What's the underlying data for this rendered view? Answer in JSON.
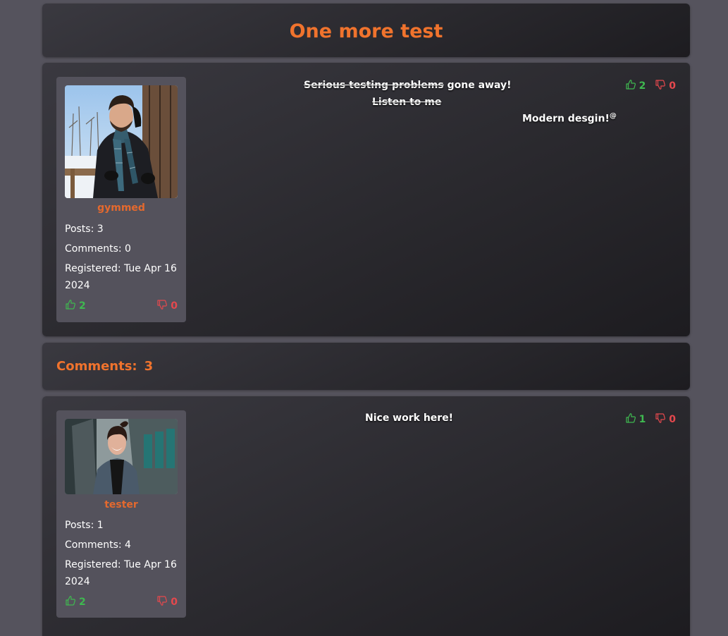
{
  "post": {
    "title": "One more test",
    "body": {
      "line1_struck": "Serious testing problems",
      "line1_rest": " gone away!",
      "line2": "Listen to me",
      "line3": "Modern desgin!",
      "line3_sup": "@"
    },
    "likes": "2",
    "dislikes": "0",
    "author": {
      "username": "gymmed",
      "posts": "Posts: 3",
      "comments": "Comments: 0",
      "registered": "Registered: Tue Apr 16 2024",
      "likes": "2",
      "dislikes": "0"
    }
  },
  "comments_section": {
    "label": "Comments:",
    "count": "3"
  },
  "comments": [
    {
      "body": "Nice work here!",
      "likes": "1",
      "dislikes": "0",
      "author": {
        "username": "tester",
        "posts": "Posts: 1",
        "comments": "Comments: 4",
        "registered": "Registered: Tue Apr 16 2024",
        "likes": "2",
        "dislikes": "0"
      }
    }
  ],
  "colors": {
    "accent": "#f0732d",
    "like": "#3fb950",
    "dislike": "#e5484d",
    "page_bg": "#55535d",
    "card_bg": "#54525c"
  },
  "icons": {
    "like": "thumbs-up-icon",
    "dislike": "thumbs-down-icon"
  }
}
